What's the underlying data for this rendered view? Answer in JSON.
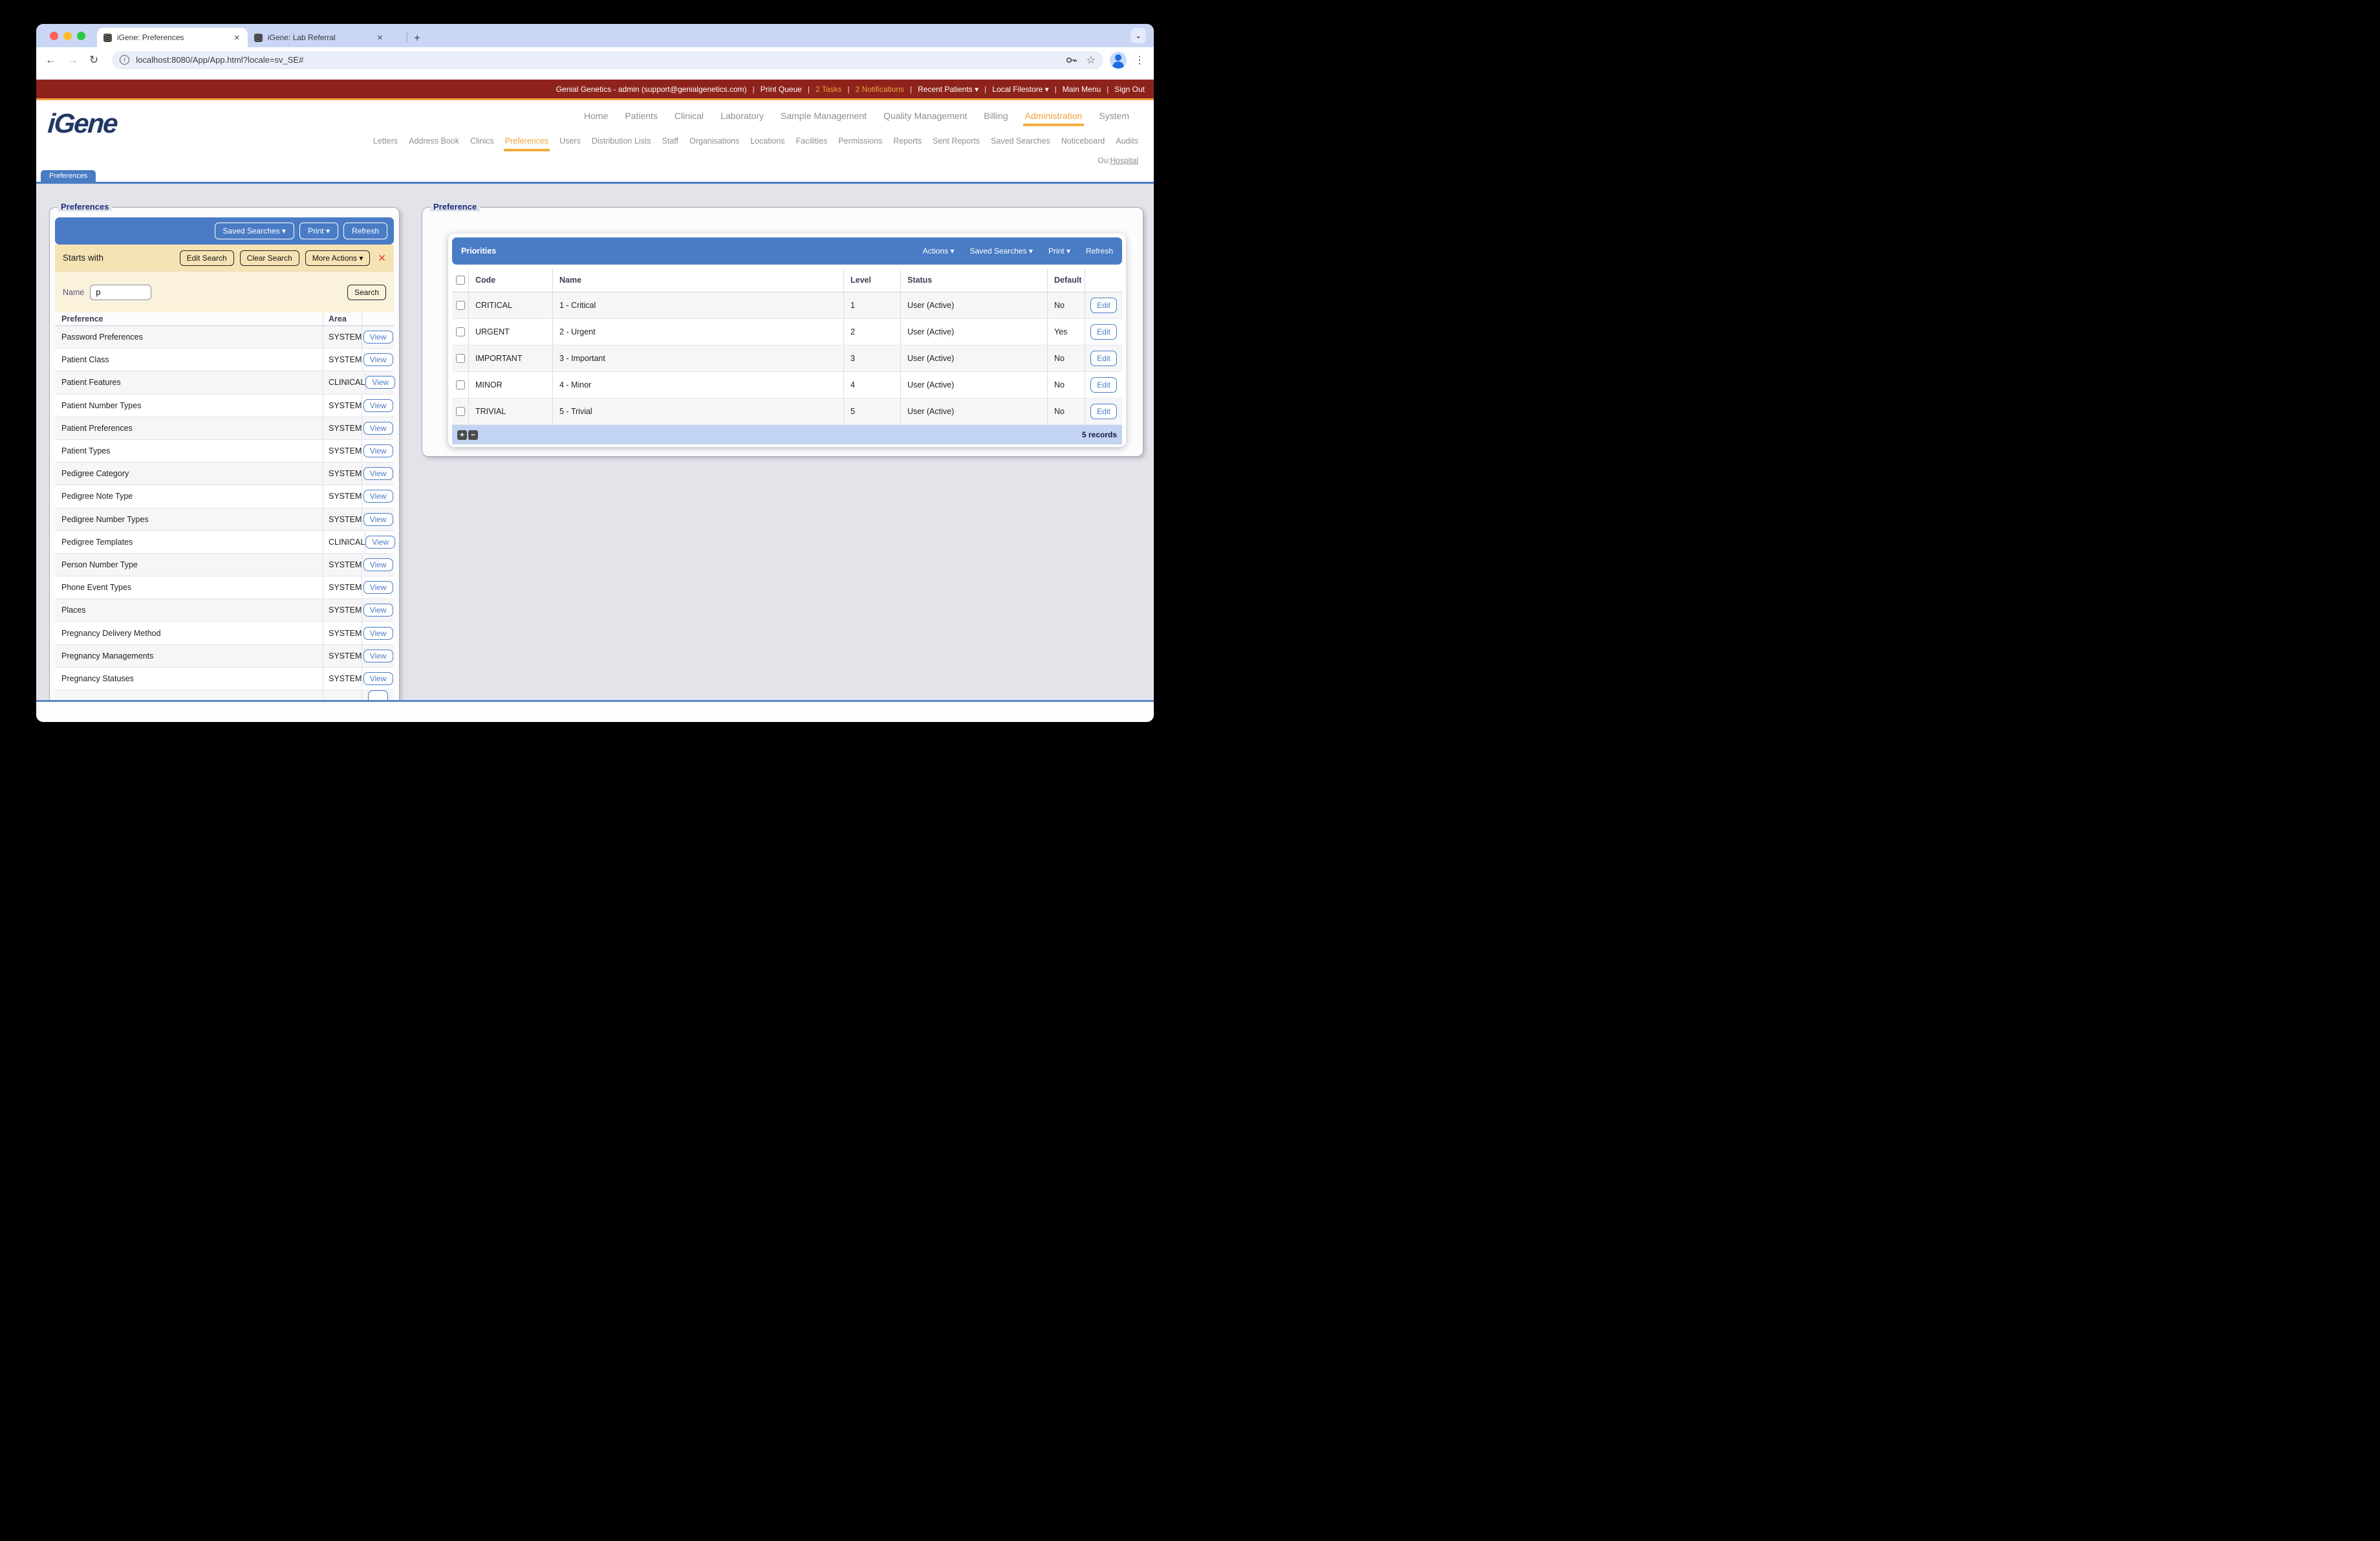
{
  "colors": {
    "accent_blue": "#4a7cc5",
    "accent_orange": "#f0a23c",
    "topbar_red": "#8e231c",
    "search_tan": "#f6e3b4",
    "footer_blue": "#c2d4f2",
    "logo_navy": "#203864"
  },
  "browser": {
    "tabs": [
      {
        "title": "iGene: Preferences",
        "close": "✕",
        "active": true
      },
      {
        "title": "iGene: Lab Referral",
        "close": "✕"
      }
    ],
    "new_tab": "+",
    "tab_search_chevron": "⌄",
    "back": "←",
    "forward": "→",
    "reload": "↻",
    "url": "localhost:8080/App/App.html?locale=sv_SE#",
    "info_glyph": "i",
    "bookmark_star": "☆",
    "menu_dots": "⋮"
  },
  "topbar": {
    "account": "Genial Genetics - admin (support@genialgenetics.com)",
    "print_queue": "Print Queue",
    "tasks": "2 Tasks",
    "notifications": "2 Notifications",
    "recent_patients": "Recent Patients ▾",
    "local_filestore": "Local Filestore ▾",
    "main_menu": "Main Menu",
    "sign_out": "Sign Out",
    "separator": "|"
  },
  "header": {
    "logo": "iGene",
    "main_nav": [
      {
        "label": "Home"
      },
      {
        "label": "Patients"
      },
      {
        "label": "Clinical"
      },
      {
        "label": "Laboratory"
      },
      {
        "label": "Sample Management"
      },
      {
        "label": "Quality Management"
      },
      {
        "label": "Billing"
      },
      {
        "label": "Administration",
        "active": true
      },
      {
        "label": "System"
      }
    ],
    "sub_nav": [
      {
        "label": "Letters"
      },
      {
        "label": "Address Book"
      },
      {
        "label": "Clinics"
      },
      {
        "label": "Preferences",
        "active": true
      },
      {
        "label": "Users"
      },
      {
        "label": "Distribution Lists"
      },
      {
        "label": "Staff"
      },
      {
        "label": "Organisations"
      },
      {
        "label": "Locations"
      },
      {
        "label": "Facilities"
      },
      {
        "label": "Permissions"
      },
      {
        "label": "Reports"
      },
      {
        "label": "Sent Reports"
      },
      {
        "label": "Saved Searches"
      },
      {
        "label": "Noticeboard"
      },
      {
        "label": "Audits"
      }
    ],
    "ou_label": "Ou:",
    "ou_value": "Hospital"
  },
  "page_tab": "Preferences",
  "left_panel": {
    "legend": "Preferences",
    "toolbar": {
      "saved_searches": "Saved Searches ▾",
      "print": "Print ▾",
      "refresh": "Refresh"
    },
    "search": {
      "mode": "Starts with",
      "edit": "Edit Search",
      "clear": "Clear Search",
      "more": "More Actions ▾",
      "close": "✕",
      "name_label": "Name",
      "name_value": "p",
      "submit": "Search"
    },
    "table": {
      "header_preference": "Preference",
      "header_area": "Area",
      "view": "View",
      "rows": [
        {
          "name": "Password Preferences",
          "area": "SYSTEM"
        },
        {
          "name": "Patient Class",
          "area": "SYSTEM"
        },
        {
          "name": "Patient Features",
          "area": "CLINICAL"
        },
        {
          "name": "Patient Number Types",
          "area": "SYSTEM"
        },
        {
          "name": "Patient Preferences",
          "area": "SYSTEM"
        },
        {
          "name": "Patient Types",
          "area": "SYSTEM"
        },
        {
          "name": "Pedigree Category",
          "area": "SYSTEM"
        },
        {
          "name": "Pedigree Note Type",
          "area": "SYSTEM"
        },
        {
          "name": "Pedigree Number Types",
          "area": "SYSTEM"
        },
        {
          "name": "Pedigree Templates",
          "area": "CLINICAL"
        },
        {
          "name": "Person Number Type",
          "area": "SYSTEM"
        },
        {
          "name": "Phone Event Types",
          "area": "SYSTEM"
        },
        {
          "name": "Places",
          "area": "SYSTEM"
        },
        {
          "name": "Pregnancy Delivery Method",
          "area": "SYSTEM"
        },
        {
          "name": "Pregnancy Managements",
          "area": "SYSTEM"
        },
        {
          "name": "Pregnancy Statuses",
          "area": "SYSTEM"
        }
      ]
    }
  },
  "right_panel": {
    "legend": "Preference",
    "card": {
      "title": "Priorities",
      "menu": {
        "actions": "Actions ▾",
        "saved_searches": "Saved Searches ▾",
        "print": "Print ▾",
        "refresh": "Refresh"
      },
      "table": {
        "header_code": "Code",
        "header_name": "Name",
        "header_level": "Level",
        "header_status": "Status",
        "header_default": "Default",
        "edit": "Edit",
        "rows": [
          {
            "code": "CRITICAL",
            "name": "1 - Critical",
            "level": "1",
            "status": "User (Active)",
            "default": "No"
          },
          {
            "code": "URGENT",
            "name": "2 - Urgent",
            "level": "2",
            "status": "User (Active)",
            "default": "Yes"
          },
          {
            "code": "IMPORTANT",
            "name": "3 - Important",
            "level": "3",
            "status": "User (Active)",
            "default": "No"
          },
          {
            "code": "MINOR",
            "name": "4 - Minor",
            "level": "4",
            "status": "User (Active)",
            "default": "No"
          },
          {
            "code": "TRIVIAL",
            "name": "5 - Trivial",
            "level": "5",
            "status": "User (Active)",
            "default": "No"
          }
        ]
      },
      "footer": {
        "add": "+",
        "remove": "−",
        "records": "5 records"
      }
    }
  }
}
